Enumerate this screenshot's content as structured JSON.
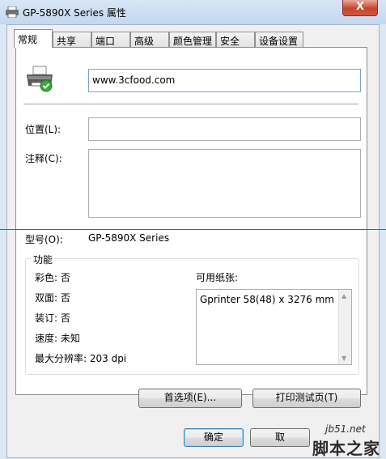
{
  "window": {
    "title": "GP-5890X Series 属性",
    "close_glyph": "X"
  },
  "tabs": [
    "常规",
    "共享",
    "端口",
    "高级",
    "颜色管理",
    "安全",
    "设备设置"
  ],
  "printer_name": "www.3cfood.com",
  "location": {
    "label": "位置(L):",
    "value": ""
  },
  "comment": {
    "label": "注释(C):",
    "value": ""
  },
  "model": {
    "label": "型号(O):",
    "value": "GP-5890X Series"
  },
  "features": {
    "title": "功能",
    "color": "彩色: 否",
    "duplex": "双面: 否",
    "staple": "装订: 否",
    "speed": "速度: 未知",
    "resolution": "最大分辨率: 203 dpi",
    "paper_label": "可用纸张:",
    "paper_sizes": [
      "Gprinter 58(48) x 3276 mm"
    ]
  },
  "buttons": {
    "preferences": "首选项(E)...",
    "test_page": "打印测试页(T)",
    "ok": "确定",
    "cancel": "取"
  },
  "watermark": {
    "site": "jb51.net",
    "name": "脚本之家"
  }
}
